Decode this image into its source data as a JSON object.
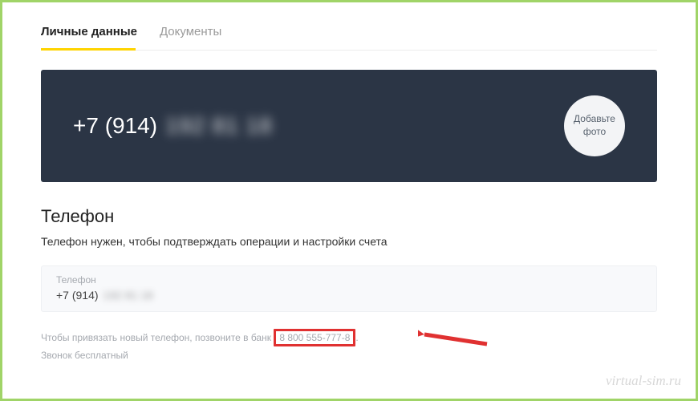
{
  "tabs": {
    "personal": "Личные данные",
    "documents": "Документы"
  },
  "header": {
    "phone_prefix": "+7 (914)",
    "phone_blurred": "192 81 18",
    "avatar_line1": "Добавьте",
    "avatar_line2": "фото"
  },
  "section": {
    "title": "Телефон",
    "desc": "Телефон нужен, чтобы подтверждать операции и настройки счета"
  },
  "phone_box": {
    "label": "Телефон",
    "value_prefix": "+7 (914)",
    "value_blurred": "192 81 18"
  },
  "hint": {
    "line1_pre": "Чтобы привязать новый телефон, позвоните в банк ",
    "highlighted": "8 800 555-777-8",
    "line1_post": ".",
    "line2": "Звонок бесплатный"
  },
  "watermark": "virtual-sim.ru"
}
